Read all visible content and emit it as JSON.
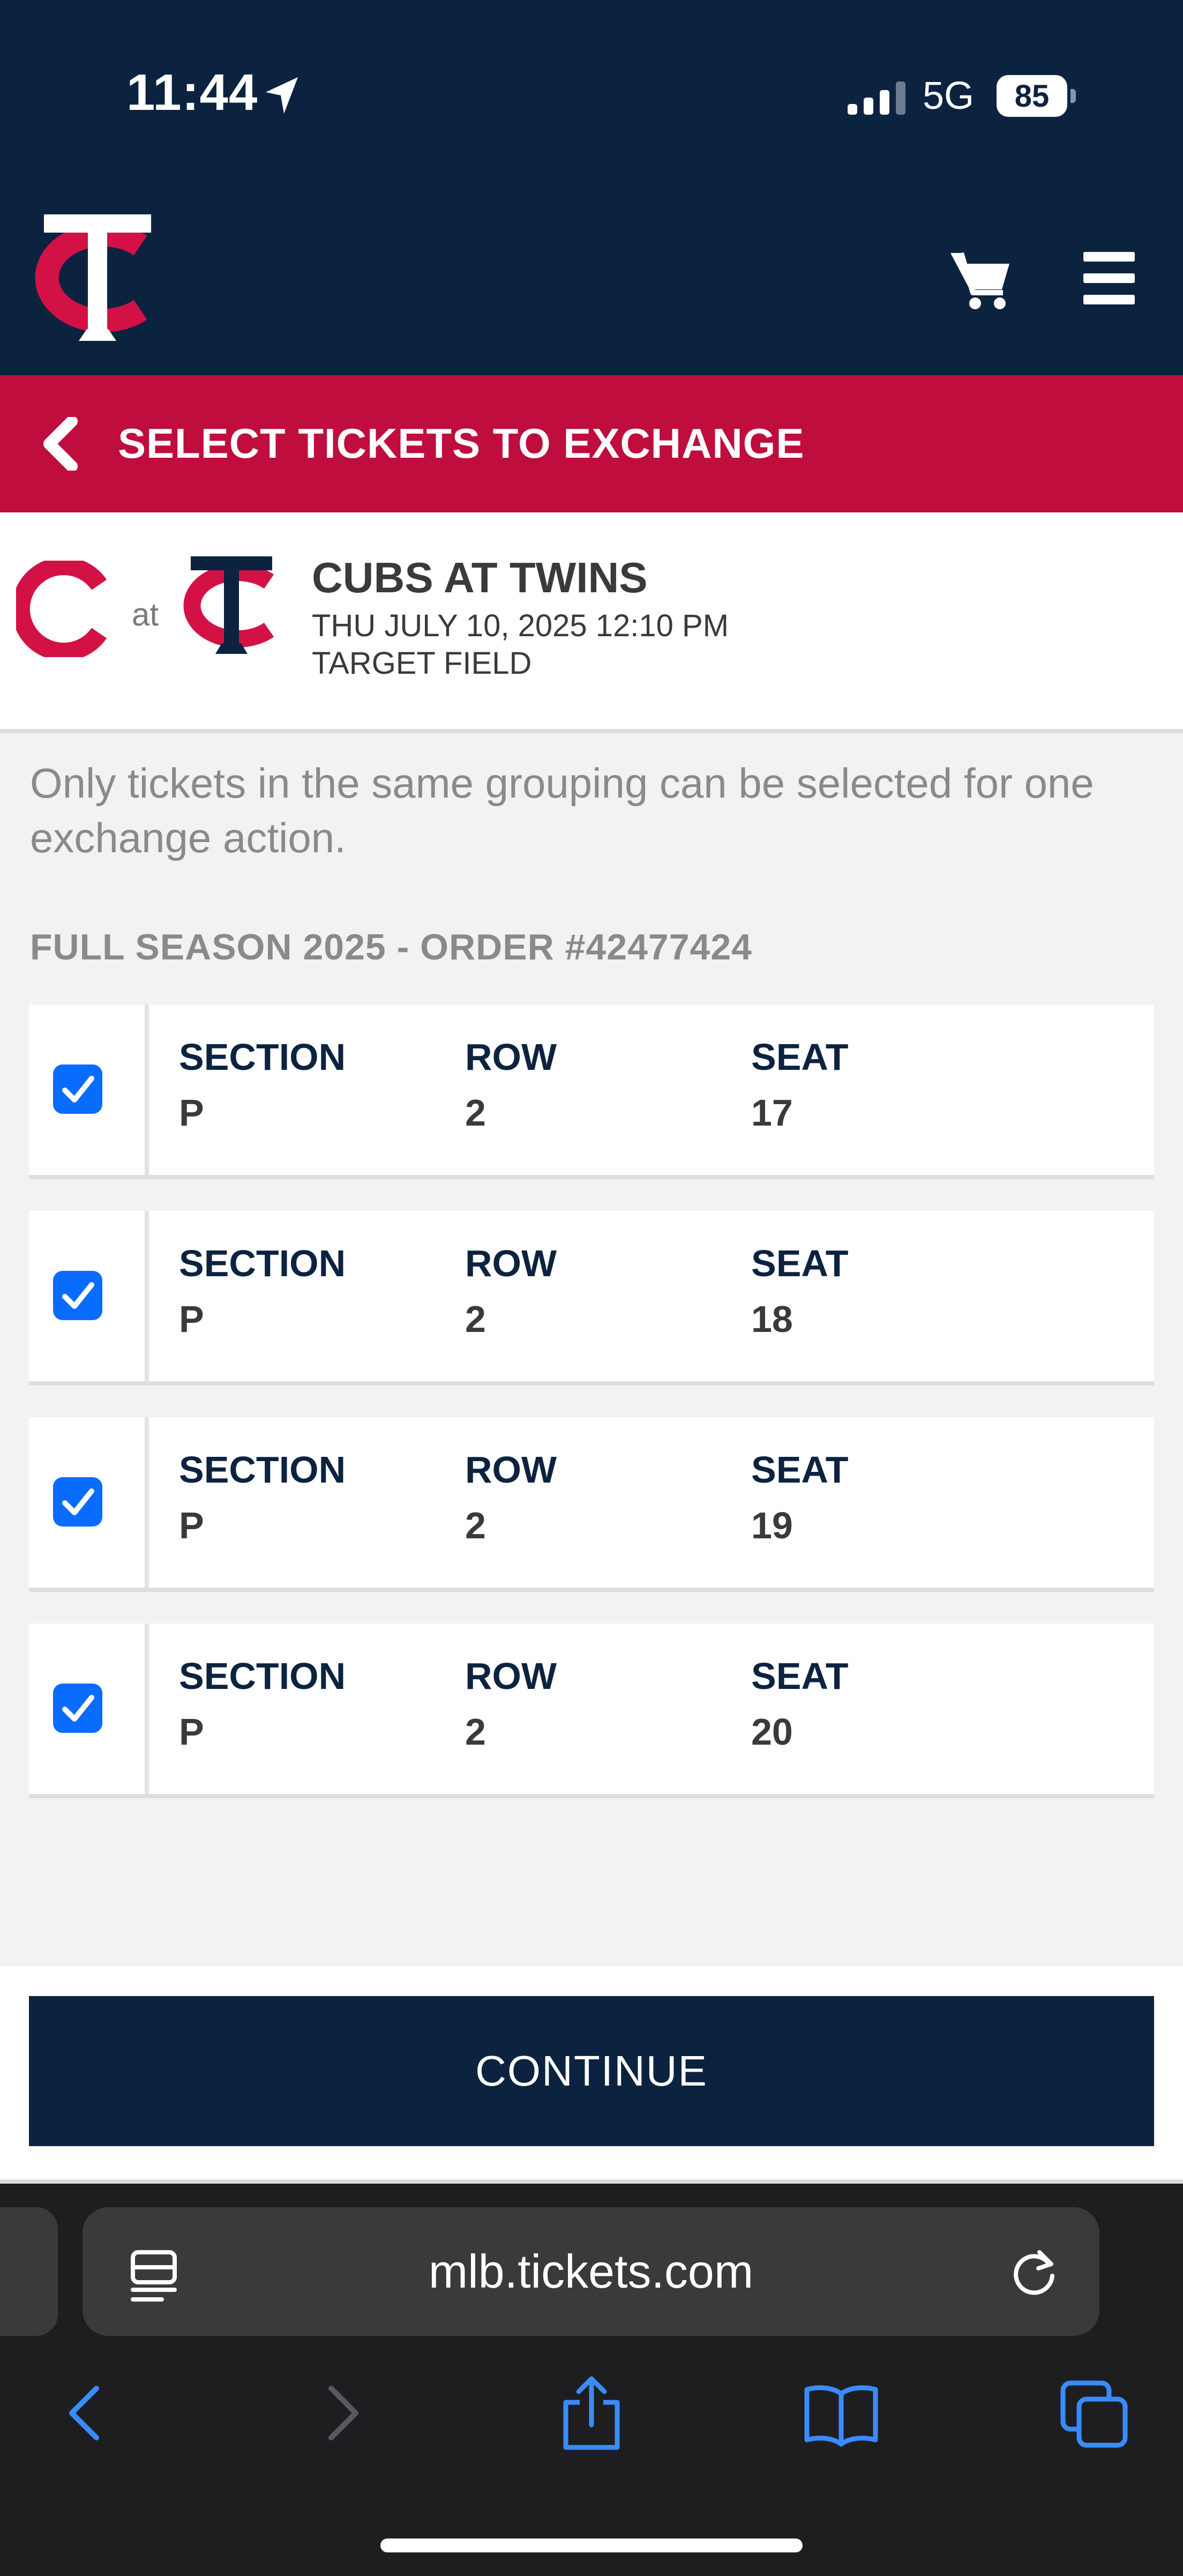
{
  "status_bar": {
    "time": "11:44",
    "network": "5G",
    "battery": "85"
  },
  "header": {
    "logo_icon": "twins-tc-logo-icon",
    "cart_icon": "cart-icon",
    "menu_icon": "hamburger-menu-icon"
  },
  "title_bar": {
    "back_icon": "chevron-left-icon",
    "title": "SELECT TICKETS TO EXCHANGE"
  },
  "game": {
    "away_logo": "cubs-logo-icon",
    "at": "at",
    "home_logo": "twins-logo-icon",
    "title": "CUBS AT TWINS",
    "datetime": "THU JULY 10, 2025 12:10 PM",
    "venue": "TARGET FIELD"
  },
  "note": "Only tickets in the same grouping can be selected for one exchange action.",
  "group_label": "FULL SEASON 2025 - ORDER #42477424",
  "seat_headers": {
    "section": "SECTION",
    "row": "ROW",
    "seat": "SEAT"
  },
  "seats": [
    {
      "section": "P",
      "row": "2",
      "seat": "17",
      "checked": true
    },
    {
      "section": "P",
      "row": "2",
      "seat": "18",
      "checked": true
    },
    {
      "section": "P",
      "row": "2",
      "seat": "19",
      "checked": true
    },
    {
      "section": "P",
      "row": "2",
      "seat": "20",
      "checked": true
    }
  ],
  "continue_label": "CONTINUE",
  "browser": {
    "url": "mlb.tickets.com",
    "icons": [
      "reader-icon",
      "reload-icon",
      "back-arrow-icon",
      "forward-arrow-icon",
      "share-icon",
      "bookmarks-icon",
      "tabs-icon"
    ]
  },
  "colors": {
    "navy": "#0c2340",
    "red": "#bf0d3e",
    "checkbox_blue": "#0a6cff"
  }
}
